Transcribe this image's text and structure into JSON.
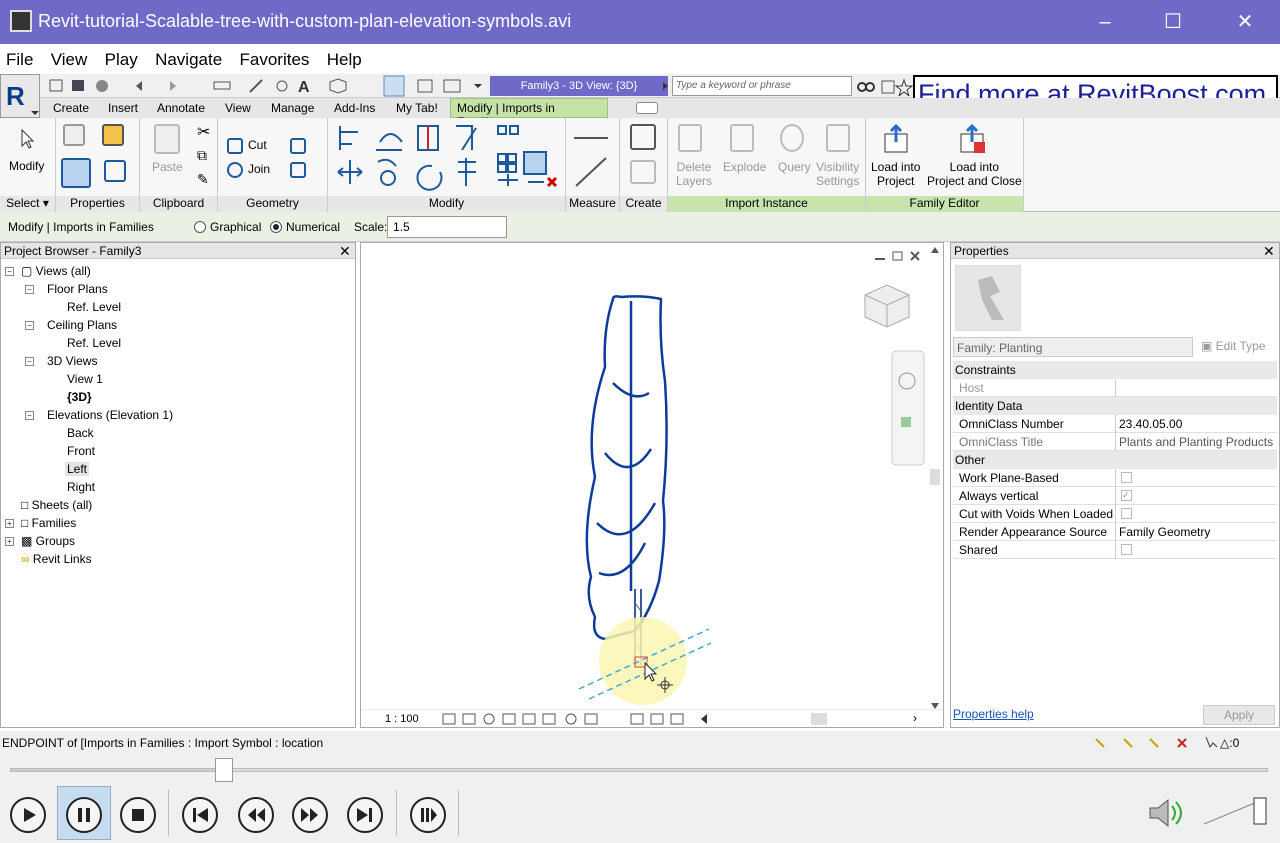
{
  "window": {
    "title": "Revit-tutorial-Scalable-tree-with-custom-plan-elevation-symbols.avi"
  },
  "menu": [
    "File",
    "View",
    "Play",
    "Navigate",
    "Favorites",
    "Help"
  ],
  "qat": {
    "view_title": "Family3 - 3D View: {3D}",
    "search_placeholder": "Type a keyword or phrase"
  },
  "promo": "Find more at RevitBoost.com",
  "tabs": [
    "Create",
    "Insert",
    "Annotate",
    "View",
    "Manage",
    "Add-Ins",
    "My Tab!",
    "Modify | Imports in Families"
  ],
  "ribbon": {
    "panels": [
      "Select",
      "Properties",
      "Clipboard",
      "Geometry",
      "Modify",
      "Measure",
      "Create",
      "Import Instance",
      "Family Editor"
    ],
    "modify": "Modify",
    "paste": "Paste",
    "cut": "Cut",
    "join": "Join",
    "delete_layers": [
      "Delete",
      "Layers"
    ],
    "explode": "Explode",
    "query": "Query",
    "visibility_settings": [
      "Visibility",
      "Settings"
    ],
    "load_into_project": [
      "Load into",
      "Project"
    ],
    "load_into_project_close": [
      "Load into",
      "Project and Close"
    ]
  },
  "options": {
    "context": "Modify | Imports in Families",
    "graphical": "Graphical",
    "numerical": "Numerical",
    "scale_label": "Scale:",
    "scale_value": "1.5"
  },
  "project_browser": {
    "title": "Project Browser - Family3",
    "nodes": [
      "Views (all)",
      "Floor Plans",
      "Ref. Level",
      "Ceiling Plans",
      "Ref. Level",
      "3D Views",
      "View 1",
      "{3D}",
      "Elevations (Elevation 1)",
      "Back",
      "Front",
      "Left",
      "Right",
      "Sheets (all)",
      "Families",
      "Groups",
      "Revit Links"
    ]
  },
  "view": {
    "scale": "1 : 100"
  },
  "properties": {
    "title": "Properties",
    "family": "Family: Planting",
    "edit_type": "Edit Type",
    "sections": {
      "constraints": "Constraints",
      "identity": "Identity Data",
      "other": "Other"
    },
    "host": "Host",
    "omniclass_number_label": "OmniClass Number",
    "omniclass_number": "23.40.05.00",
    "omniclass_title_label": "OmniClass Title",
    "omniclass_title": "Plants and Planting Products",
    "work_plane": "Work Plane-Based",
    "always_vertical": "Always vertical",
    "cut_voids": "Cut with Voids When Loaded",
    "render_label": "Render Appearance Source",
    "render_value": "Family Geometry",
    "shared": "Shared",
    "help": "Properties help",
    "apply": "Apply"
  },
  "status": {
    "text": "ENDPOINT  of [Imports in Families : Import Symbol : location",
    "filter_count": ":0"
  },
  "player": {
    "progress": 0.17
  }
}
